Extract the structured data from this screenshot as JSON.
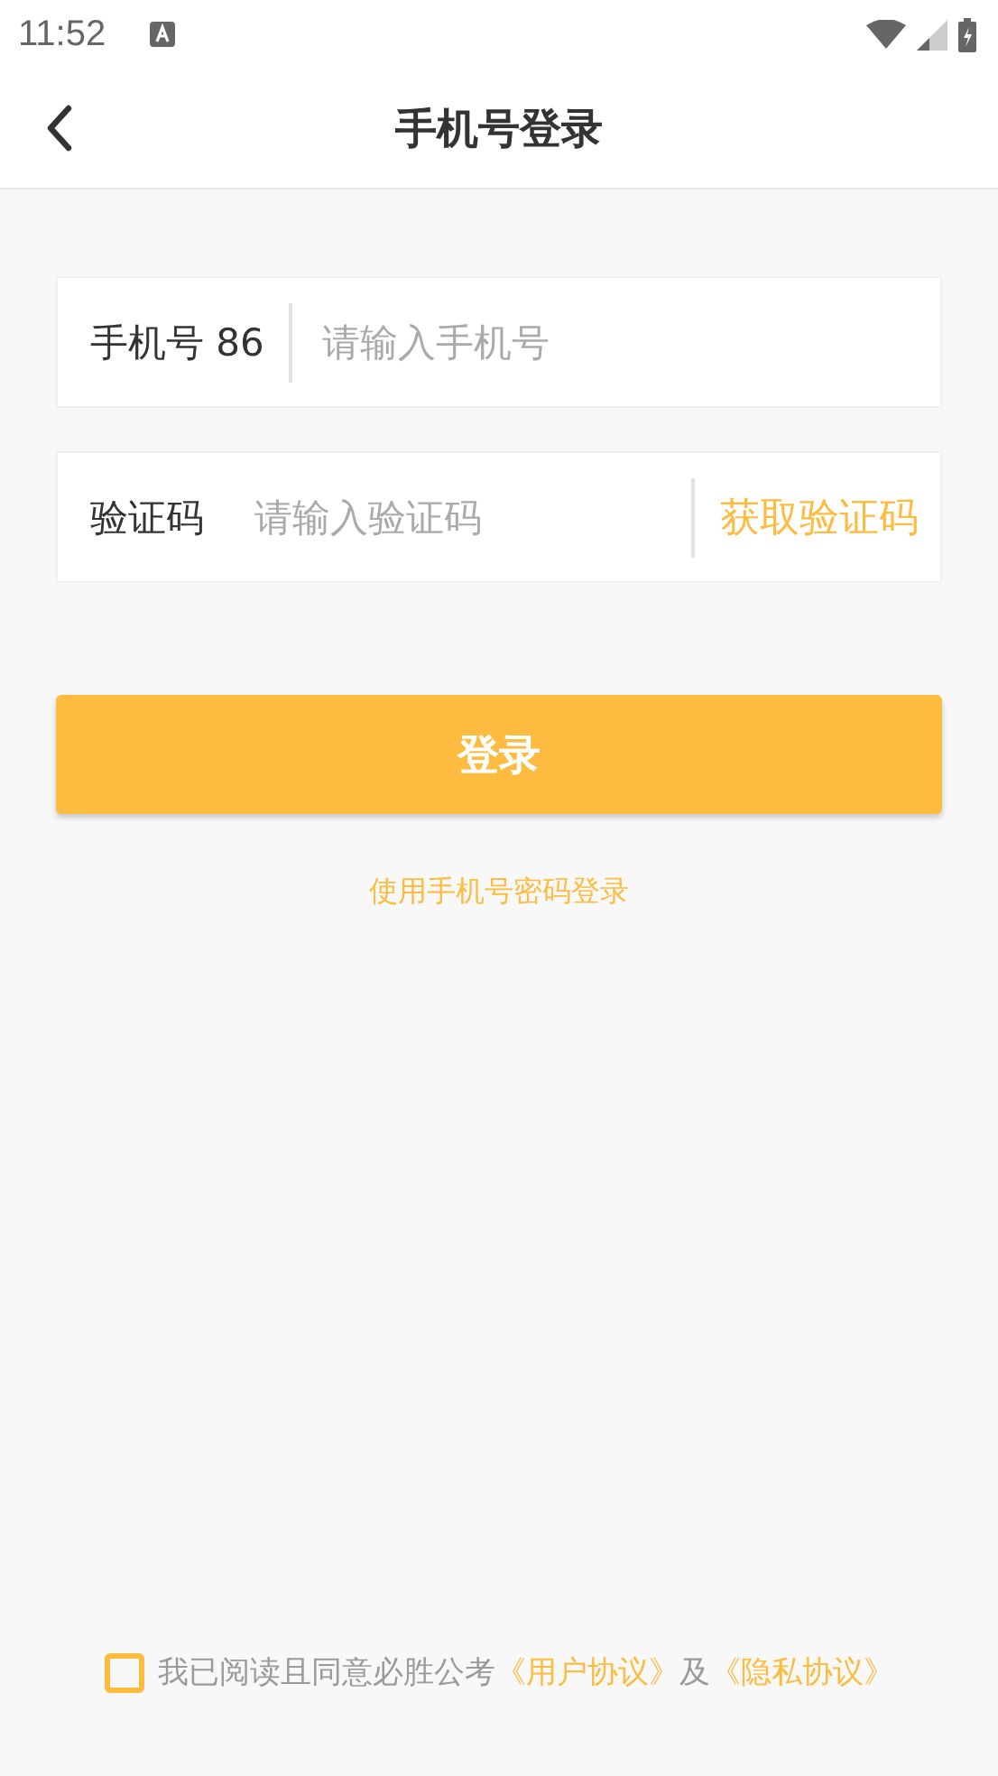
{
  "status_bar": {
    "time": "11:52"
  },
  "header": {
    "title": "手机号登录"
  },
  "phone_field": {
    "label": "手机号 86",
    "placeholder": "请输入手机号"
  },
  "code_field": {
    "label": "验证码",
    "placeholder": "请输入验证码",
    "action": "获取验证码"
  },
  "login_button": "登录",
  "alt_login_link": "使用手机号密码登录",
  "agreement": {
    "checked": false,
    "text": "我已阅读且同意必胜公考",
    "link_1": "《用户协议》",
    "joiner": "及",
    "link_2": "《隐私协议》"
  }
}
